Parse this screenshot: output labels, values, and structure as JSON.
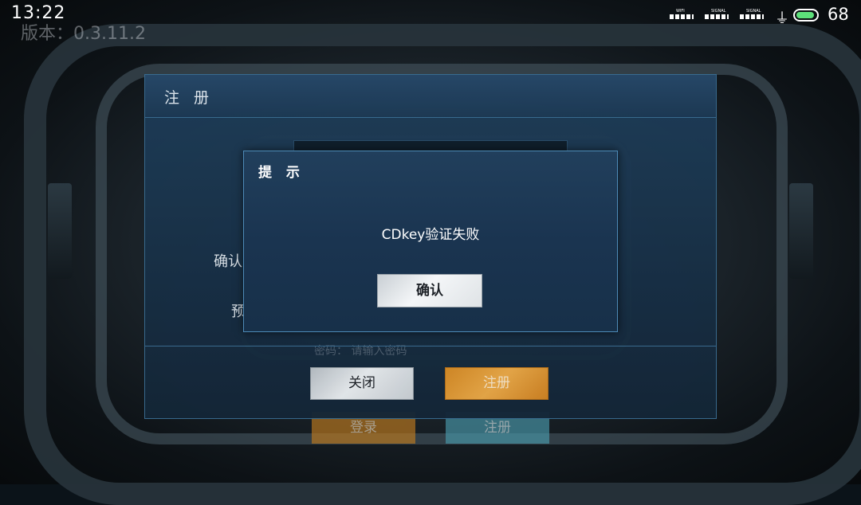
{
  "status_bar": {
    "time": "13:22",
    "signal_labels": [
      "WIFI",
      "SIGNAL",
      "SIGNAL"
    ],
    "battery_percent": "68",
    "battery_level": 0.68,
    "charging_icon": "plug-icon",
    "battery_color": "#5de07a"
  },
  "version_label": "版本：0.3.11.2",
  "background_buttons": {
    "login_label": "登录",
    "register_label": "注册"
  },
  "register_dialog": {
    "title": "注 册",
    "confirm_label_partial": "确认",
    "preset_label_partial": "预",
    "faint_text": "密码：  请输入密码",
    "close_label": "关闭",
    "register_label": "注册"
  },
  "alert_dialog": {
    "title": "提 示",
    "message": "CDkey验证失败",
    "ok_label": "确认"
  },
  "colors": {
    "dialog_bg": "#1a3450",
    "dialog_border": "#4d8ab7",
    "accent_orange": "#d58a25"
  }
}
